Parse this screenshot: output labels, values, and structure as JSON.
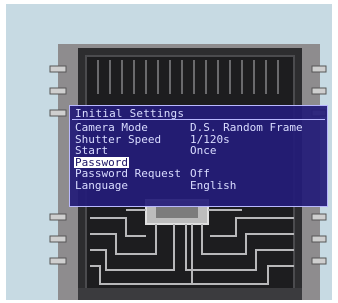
{
  "osd": {
    "title": "Initial Settings",
    "items": [
      {
        "label": "Camera Mode",
        "value": "D.S. Random Frame",
        "selected": false
      },
      {
        "label": "Shutter Speed",
        "value": "1/120s",
        "selected": false
      },
      {
        "label": "Start",
        "value": "Once",
        "selected": false
      },
      {
        "label": "Password",
        "value": "",
        "selected": true
      },
      {
        "label": "Password Request",
        "value": "Off",
        "selected": false
      },
      {
        "label": "Language",
        "value": "English",
        "selected": false
      }
    ]
  },
  "colors": {
    "screen_background": "#c7dae3",
    "osd_background": "#241c78",
    "osd_text": "#d9dcff",
    "highlight_background": "#ffffff",
    "highlight_text": "#1b1466"
  }
}
